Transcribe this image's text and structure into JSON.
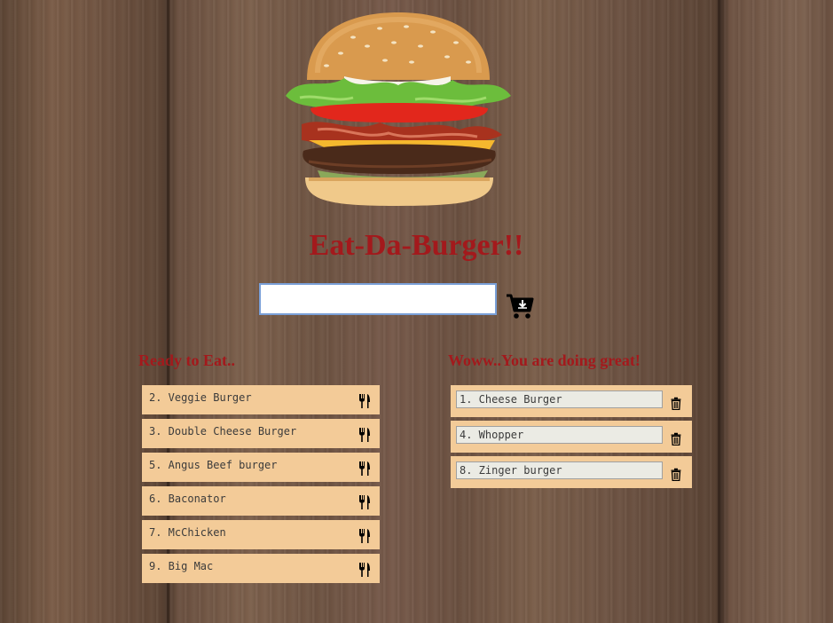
{
  "app": {
    "title": "Eat-Da-Burger!!"
  },
  "form": {
    "input_value": "",
    "input_placeholder": "",
    "submit_icon": "cart-download-icon"
  },
  "ready": {
    "heading": "Ready to Eat..",
    "action_icon": "fork-knife-icon",
    "items": [
      {
        "label": "2. Veggie Burger"
      },
      {
        "label": "3. Double Cheese Burger"
      },
      {
        "label": "5. Angus Beef burger"
      },
      {
        "label": "6. Baconator"
      },
      {
        "label": "7. McChicken"
      },
      {
        "label": "9. Big Mac"
      }
    ]
  },
  "devoured": {
    "heading": "Woww..You are doing great!",
    "action_icon": "trash-icon",
    "items": [
      {
        "label": "1. Cheese Burger"
      },
      {
        "label": "4. Whopper"
      },
      {
        "label": "8. Zinger burger"
      }
    ]
  },
  "colors": {
    "accent": "#a3191c",
    "card": "#f3cb98",
    "field": "#ebebe4"
  }
}
